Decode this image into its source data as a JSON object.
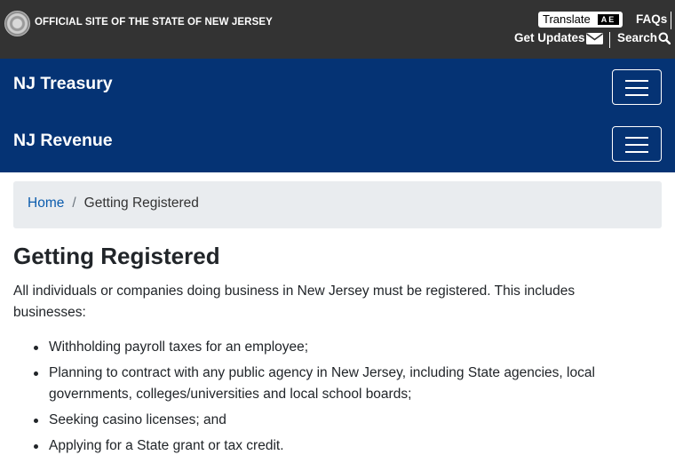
{
  "statebar": {
    "official_text": "OFFICIAL SITE OF THE STATE OF NEW JERSEY",
    "translate_label": "Translate",
    "translate_icon_text": "AE",
    "faqs_label": "FAQs",
    "get_updates_label": "Get Updates",
    "search_label": "Search"
  },
  "nav": {
    "site_title_1": "NJ Treasury",
    "site_title_2": "NJ Revenue"
  },
  "breadcrumb": {
    "home": "Home",
    "separator": "/",
    "current": "Getting Registered"
  },
  "main": {
    "title": "Getting Registered",
    "intro": "All individuals or companies doing business in New Jersey must be registered. This includes businesses:",
    "items": [
      "Withholding payroll taxes for an employee;",
      "Planning to contract with any public agency in New Jersey, including State agencies, local governments, colleges/universities and local school boards;",
      "Seeking casino licenses; and",
      "Applying for a State grant or tax credit."
    ]
  },
  "colors": {
    "state_bar": "#333333",
    "nav_blue": "#053374",
    "link_blue": "#0b5cad",
    "breadcrumb_bg": "#e9ecef"
  },
  "icons": [
    "state-seal-icon",
    "translate-icon",
    "envelope-icon",
    "search-icon",
    "hamburger-menu-icon"
  ]
}
